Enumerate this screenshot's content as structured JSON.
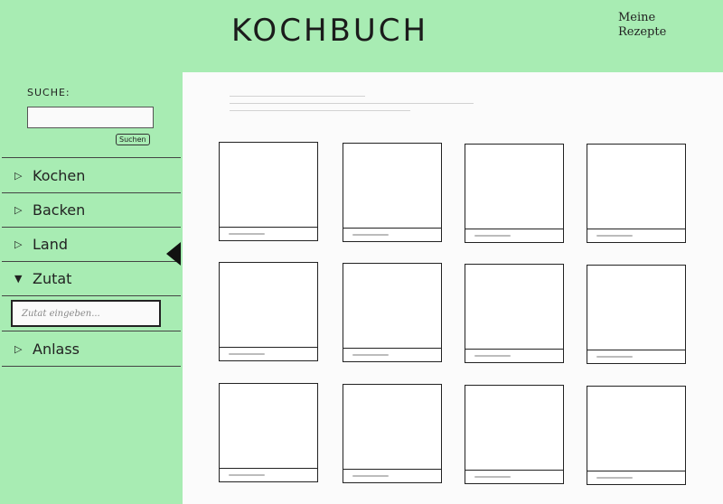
{
  "header": {
    "title": "KOCHBUCH",
    "my_recipes_line1": "Meine",
    "my_recipes_line2": "Rezepte"
  },
  "sidebar": {
    "search_label": "SUCHE:",
    "search_button": "Suchen",
    "items": [
      {
        "label": "Kochen",
        "arrow": "▷"
      },
      {
        "label": "Backen",
        "arrow": "▷"
      },
      {
        "label": "Land",
        "arrow": "▷"
      },
      {
        "label": "Zutat",
        "arrow": "▼"
      },
      {
        "label": "Anlass",
        "arrow": "▷"
      }
    ],
    "ingredient_placeholder": "Zutat eingeben..."
  },
  "colors": {
    "panel": "#a8ecb3",
    "content": "#fbfbfb",
    "outline": "#222222"
  },
  "icons": {
    "collapsed": "triangle-right-icon",
    "expanded": "triangle-down-icon",
    "active_marker": "triangle-left-icon"
  }
}
